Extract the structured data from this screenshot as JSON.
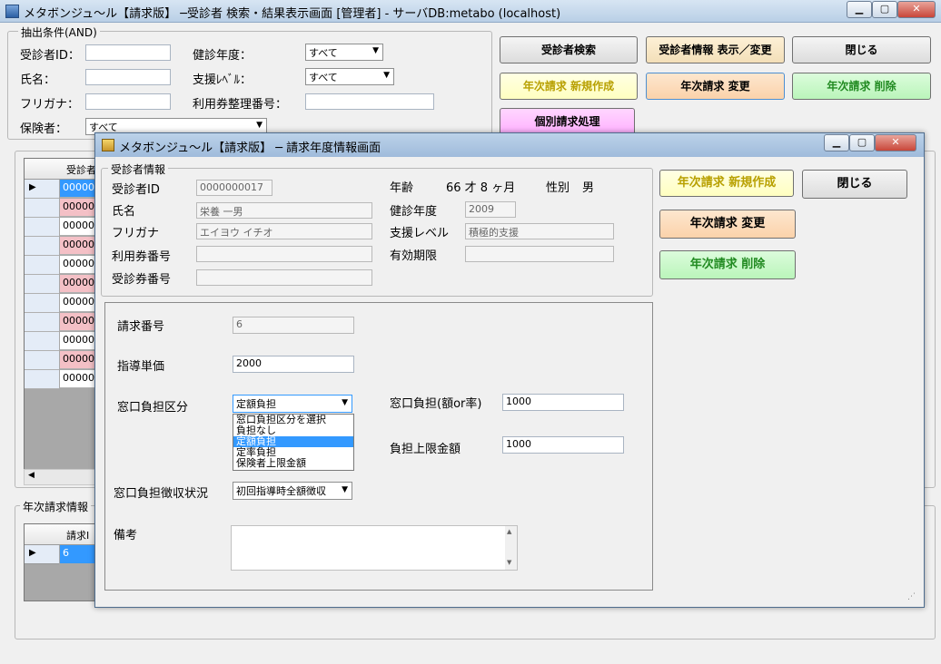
{
  "main_window": {
    "title": "メタボンジュ～ル【請求版】 ─受診者 検索・結果表示画面 [管理者] - サーバDB:metabo (localhost)",
    "extract_group_label": "抽出条件(AND)",
    "labels": {
      "patient_id": "受診者ID：",
      "name": "氏名：",
      "furigana": "フリガナ：",
      "insurer": "保険者：",
      "checkup_year": "健診年度：",
      "support_level": "支援ﾚﾍﾞﾙ：",
      "voucher_no": "利用券整理番号："
    },
    "values": {
      "checkup_year": "すべて",
      "support_level": "すべて",
      "insurer": "すべて"
    },
    "buttons": {
      "search": "受診者検索",
      "info_show_change": "受診者情報 表示／変更",
      "close": "閉じる",
      "annual_new": "年次請求 新規作成",
      "annual_change": "年次請求 変更",
      "annual_delete": "年次請求 削除",
      "individual": "個別請求処理"
    },
    "grid1": {
      "header": "受診者",
      "rows": [
        "000000",
        "000000",
        "000000",
        "000000",
        "000000",
        "000000",
        "000000",
        "000000",
        "000000",
        "000000",
        "000000"
      ]
    },
    "annual_group_label": "年次請求情報",
    "grid2": {
      "header": "請求I",
      "row_value": "6"
    }
  },
  "dialog": {
    "title": "メタボンジュ～ル【請求版】 ─ 請求年度情報画面",
    "patient_group_label": "受診者情報",
    "labels": {
      "patient_id": "受診者ID",
      "name": "氏名",
      "furigana": "フリガナ",
      "voucher_no": "利用券番号",
      "checkup_no": "受診券番号",
      "age": "年齢",
      "age_value": "66 才  8 ヶ月",
      "sex_label": "性別",
      "sex_value": "男",
      "checkup_year": "健診年度",
      "support_level": "支援レベル",
      "valid_until": "有効期限",
      "claim_no": "請求番号",
      "guidance_unit_price": "指導単価",
      "window_burden_type": "窓口負担区分",
      "window_burden_amount": "窓口負担(額or率)",
      "burden_max": "負担上限金額",
      "window_burden_collection": "窓口負担徴収状況",
      "remarks": "備考"
    },
    "values": {
      "patient_id": "0000000017",
      "name": "栄養 一男",
      "furigana": "エイヨウ イチオ",
      "voucher_no": "",
      "checkup_no": "",
      "checkup_year": "2009",
      "support_level": "積極的支援",
      "valid_until": "",
      "claim_no": "6",
      "guidance_unit_price": "2000",
      "window_burden_type": "定額負担",
      "window_burden_amount": "1000",
      "burden_max": "1000",
      "window_burden_collection": "初回指導時全額徴収",
      "remarks": ""
    },
    "dropdown_options": [
      "窓口負担区分を選択",
      "負担なし",
      "定額負担",
      "定率負担",
      "保険者上限金額"
    ],
    "dropdown_selected_index": 2,
    "buttons": {
      "annual_new": "年次請求 新規作成",
      "close": "閉じる",
      "annual_change": "年次請求 変更",
      "annual_delete": "年次請求 削除"
    }
  }
}
